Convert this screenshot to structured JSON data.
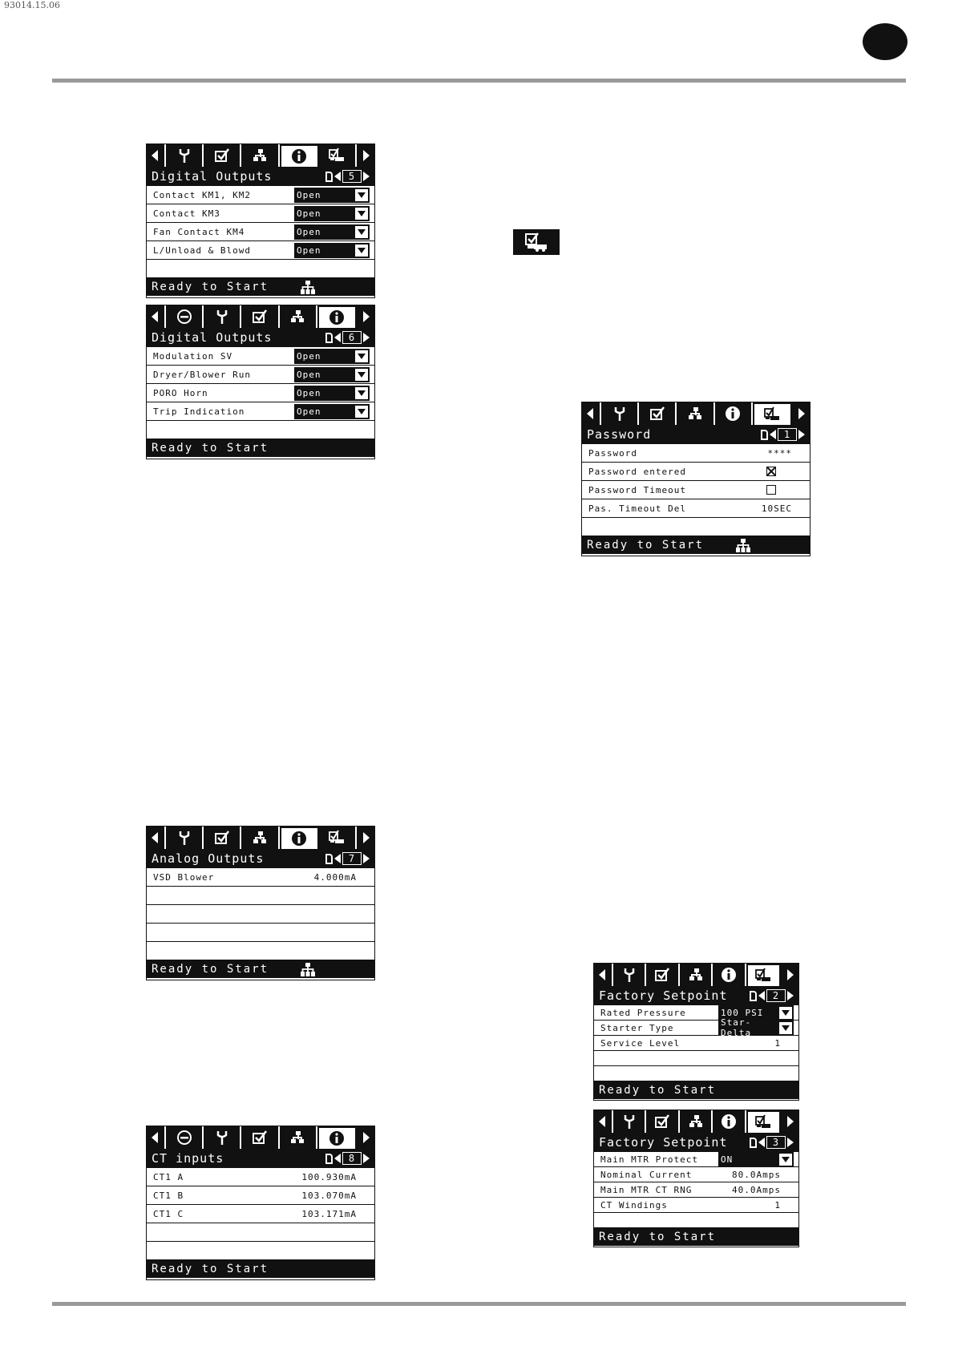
{
  "doc_number": "93014.15.06",
  "status_text": "Ready to Start",
  "panels": [
    {
      "title": "Digital Outputs",
      "page": "5",
      "rows": [
        {
          "label": "Contact KM1, KM2",
          "dropdown": "Open"
        },
        {
          "label": "Contact KM3",
          "dropdown": "Open"
        },
        {
          "label": "Fan Contact KM4",
          "dropdown": "Open"
        },
        {
          "label": "L/Unload & Blowd",
          "dropdown": "Open"
        }
      ]
    },
    {
      "title": "Digital Outputs",
      "page": "6",
      "rows": [
        {
          "label": "Modulation SV",
          "dropdown": "Open"
        },
        {
          "label": "Dryer/Blower Run",
          "dropdown": "Open"
        },
        {
          "label": "PORO Horn",
          "dropdown": "Open"
        },
        {
          "label": "Trip Indication",
          "dropdown": "Open"
        }
      ]
    },
    {
      "title": "Password",
      "page": "1",
      "rows": [
        {
          "label": "Password",
          "value": "****"
        },
        {
          "label": "Password entered",
          "checked": true
        },
        {
          "label": "Password Timeout",
          "checked": false
        },
        {
          "label": "Pas. Timeout Del",
          "value": "10SEC"
        }
      ]
    },
    {
      "title": "Analog Outputs",
      "page": "7",
      "rows": [
        {
          "label": "VSD Blower",
          "value": "4.000mA"
        }
      ]
    },
    {
      "title": "Factory Setpoint",
      "page": "2",
      "rows": [
        {
          "label": "Rated Pressure",
          "dropdown": "100 PSI"
        },
        {
          "label": "Starter Type",
          "dropdown": "Star-Delta"
        },
        {
          "label": "Service Level",
          "value": "1"
        }
      ]
    },
    {
      "title": "CT inputs",
      "page": "8",
      "rows": [
        {
          "label": "CT1 A",
          "value": "100.930mA"
        },
        {
          "label": "CT1 B",
          "value": "103.070mA"
        },
        {
          "label": "CT1 C",
          "value": "103.171mA"
        }
      ]
    },
    {
      "title": "Factory Setpoint",
      "page": "3",
      "rows": [
        {
          "label": "Main MTR Protect",
          "dropdown": "ON"
        },
        {
          "label": "Nominal Current",
          "value": "80.0Amps"
        },
        {
          "label": "Main MTR CT RNG",
          "value": "40.0Amps"
        },
        {
          "label": "CT Windings",
          "value": "1"
        }
      ]
    }
  ]
}
